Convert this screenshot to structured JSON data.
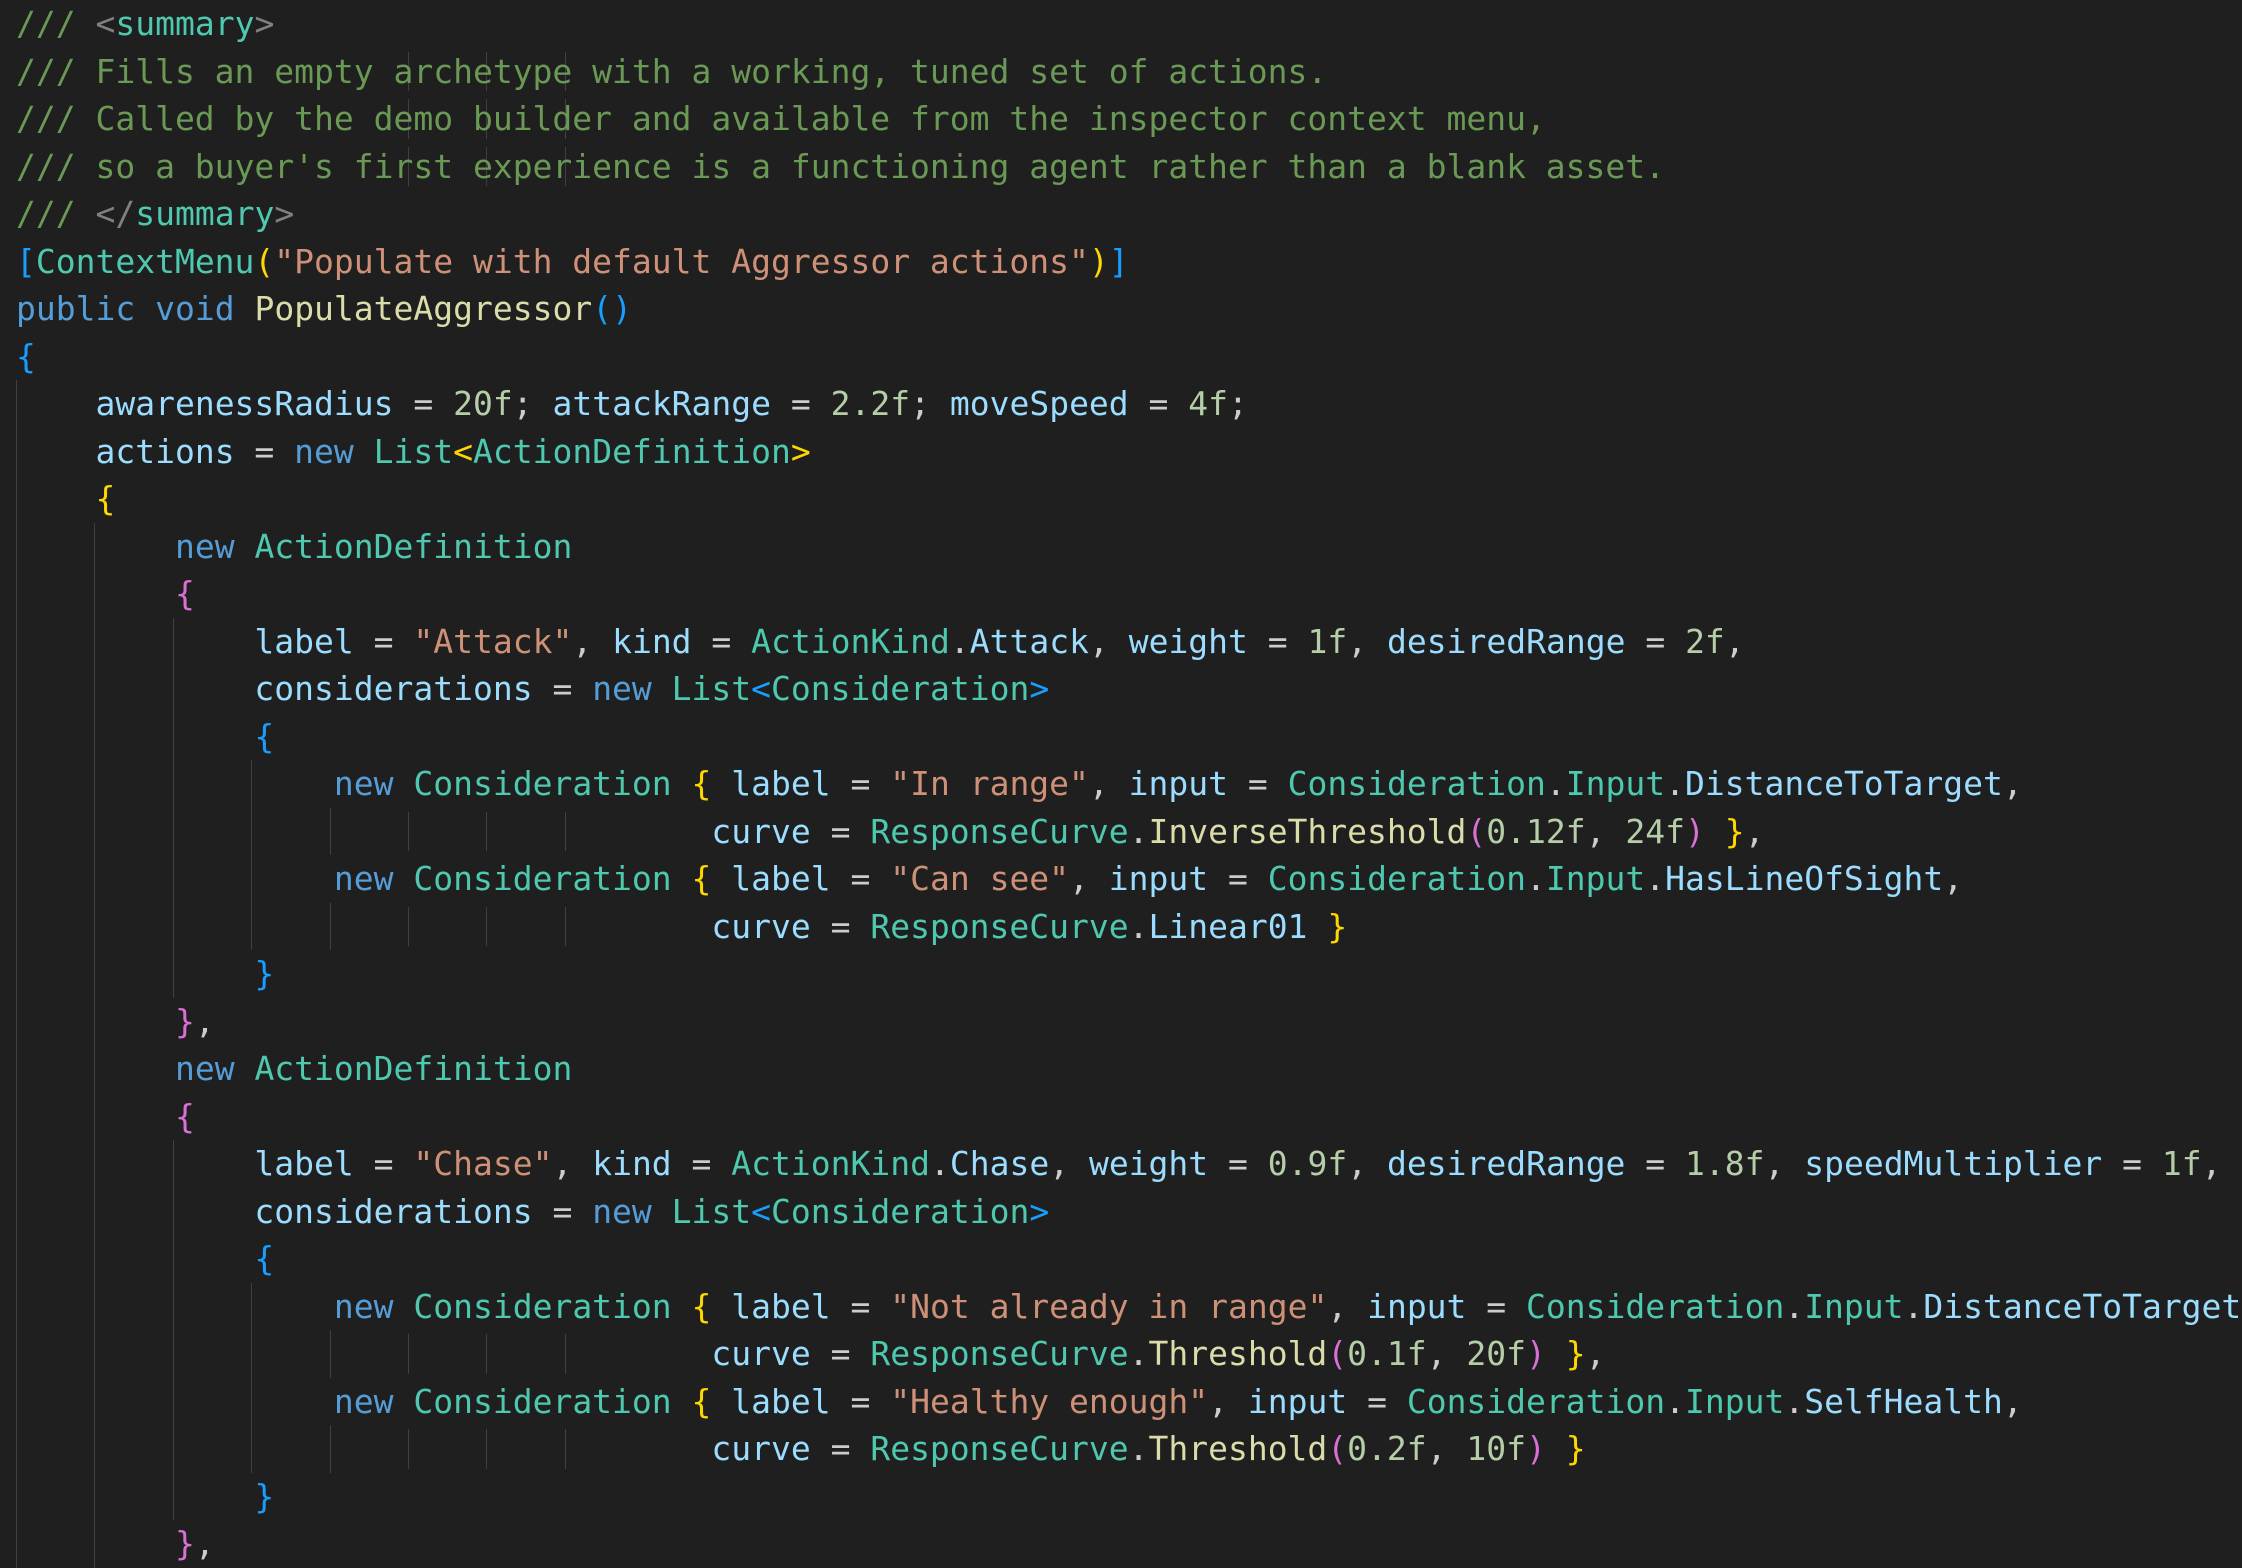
{
  "editor": {
    "language": "csharp",
    "colors": {
      "background": "#1f1f1f",
      "comment": "#6a9955",
      "keyword": "#569cd6",
      "type": "#4ec9b0",
      "method": "#dcdcaa",
      "string": "#ce9178",
      "number": "#b5cea8",
      "identifier": "#9cdcfe",
      "plain": "#cccccc",
      "bracket_level_1": "#ffd700",
      "bracket_level_2": "#da70d6",
      "bracket_level_3": "#179fff"
    },
    "lines": [
      [
        [
          "t-comment",
          "/// "
        ],
        [
          "t-tag",
          "<"
        ],
        [
          "t-tagname",
          "summary"
        ],
        [
          "t-tag",
          ">"
        ]
      ],
      [
        [
          "t-comment",
          "/// Fills an empty archetype with a working, tuned set of actions."
        ]
      ],
      [
        [
          "t-comment",
          "/// Called by the demo builder and available from the inspector context menu,"
        ]
      ],
      [
        [
          "t-comment",
          "/// so a buyer's first experience is a functioning agent rather than a blank asset."
        ]
      ],
      [
        [
          "t-comment",
          "/// "
        ],
        [
          "t-tag",
          "</"
        ],
        [
          "t-tagname",
          "summary"
        ],
        [
          "t-tag",
          ">"
        ]
      ],
      [
        [
          "t-b3",
          "["
        ],
        [
          "t-type",
          "ContextMenu"
        ],
        [
          "t-b1",
          "("
        ],
        [
          "t-string",
          "\"Populate with default Aggressor actions\""
        ],
        [
          "t-b1",
          ")"
        ],
        [
          "t-b3",
          "]"
        ]
      ],
      [
        [
          "t-keyword",
          "public"
        ],
        [
          "t-plain",
          " "
        ],
        [
          "t-keyword",
          "void"
        ],
        [
          "t-plain",
          " "
        ],
        [
          "t-method",
          "PopulateAggressor"
        ],
        [
          "t-b3",
          "()"
        ]
      ],
      [
        [
          "t-b3",
          "{"
        ]
      ],
      [
        [
          "t-plain",
          "    "
        ],
        [
          "t-ident",
          "awarenessRadius"
        ],
        [
          "t-plain",
          " = "
        ],
        [
          "t-number",
          "20f"
        ],
        [
          "t-plain",
          "; "
        ],
        [
          "t-ident",
          "attackRange"
        ],
        [
          "t-plain",
          " = "
        ],
        [
          "t-number",
          "2.2f"
        ],
        [
          "t-plain",
          "; "
        ],
        [
          "t-ident",
          "moveSpeed"
        ],
        [
          "t-plain",
          " = "
        ],
        [
          "t-number",
          "4f"
        ],
        [
          "t-plain",
          ";"
        ]
      ],
      [
        [
          "t-plain",
          "    "
        ],
        [
          "t-ident",
          "actions"
        ],
        [
          "t-plain",
          " = "
        ],
        [
          "t-keyword",
          "new"
        ],
        [
          "t-plain",
          " "
        ],
        [
          "t-type",
          "List"
        ],
        [
          "t-b1",
          "<"
        ],
        [
          "t-type",
          "ActionDefinition"
        ],
        [
          "t-b1",
          ">"
        ]
      ],
      [
        [
          "t-plain",
          "    "
        ],
        [
          "t-b1",
          "{"
        ]
      ],
      [
        [
          "t-plain",
          "        "
        ],
        [
          "t-keyword",
          "new"
        ],
        [
          "t-plain",
          " "
        ],
        [
          "t-type",
          "ActionDefinition"
        ]
      ],
      [
        [
          "t-plain",
          "        "
        ],
        [
          "t-b2",
          "{"
        ]
      ],
      [
        [
          "t-plain",
          "            "
        ],
        [
          "t-ident",
          "label"
        ],
        [
          "t-plain",
          " = "
        ],
        [
          "t-string",
          "\"Attack\""
        ],
        [
          "t-plain",
          ", "
        ],
        [
          "t-ident",
          "kind"
        ],
        [
          "t-plain",
          " = "
        ],
        [
          "t-type",
          "ActionKind"
        ],
        [
          "t-plain",
          "."
        ],
        [
          "t-ident",
          "Attack"
        ],
        [
          "t-plain",
          ", "
        ],
        [
          "t-ident",
          "weight"
        ],
        [
          "t-plain",
          " = "
        ],
        [
          "t-number",
          "1f"
        ],
        [
          "t-plain",
          ", "
        ],
        [
          "t-ident",
          "desiredRange"
        ],
        [
          "t-plain",
          " = "
        ],
        [
          "t-number",
          "2f"
        ],
        [
          "t-plain",
          ","
        ]
      ],
      [
        [
          "t-plain",
          "            "
        ],
        [
          "t-ident",
          "considerations"
        ],
        [
          "t-plain",
          " = "
        ],
        [
          "t-keyword",
          "new"
        ],
        [
          "t-plain",
          " "
        ],
        [
          "t-type",
          "List"
        ],
        [
          "t-b3",
          "<"
        ],
        [
          "t-type",
          "Consideration"
        ],
        [
          "t-b3",
          ">"
        ]
      ],
      [
        [
          "t-plain",
          "            "
        ],
        [
          "t-b3",
          "{"
        ]
      ],
      [
        [
          "t-plain",
          "                "
        ],
        [
          "t-keyword",
          "new"
        ],
        [
          "t-plain",
          " "
        ],
        [
          "t-type",
          "Consideration"
        ],
        [
          "t-plain",
          " "
        ],
        [
          "t-b1",
          "{"
        ],
        [
          "t-plain",
          " "
        ],
        [
          "t-ident",
          "label"
        ],
        [
          "t-plain",
          " = "
        ],
        [
          "t-string",
          "\"In range\""
        ],
        [
          "t-plain",
          ", "
        ],
        [
          "t-ident",
          "input"
        ],
        [
          "t-plain",
          " = "
        ],
        [
          "t-type",
          "Consideration"
        ],
        [
          "t-plain",
          "."
        ],
        [
          "t-type",
          "Input"
        ],
        [
          "t-plain",
          "."
        ],
        [
          "t-ident",
          "DistanceToTarget"
        ],
        [
          "t-plain",
          ","
        ]
      ],
      [
        [
          "t-plain",
          "                                   "
        ],
        [
          "t-ident",
          "curve"
        ],
        [
          "t-plain",
          " = "
        ],
        [
          "t-type",
          "ResponseCurve"
        ],
        [
          "t-plain",
          "."
        ],
        [
          "t-method",
          "InverseThreshold"
        ],
        [
          "t-b2",
          "("
        ],
        [
          "t-number",
          "0.12f"
        ],
        [
          "t-plain",
          ", "
        ],
        [
          "t-number",
          "24f"
        ],
        [
          "t-b2",
          ")"
        ],
        [
          "t-plain",
          " "
        ],
        [
          "t-b1",
          "}"
        ],
        [
          "t-plain",
          ","
        ]
      ],
      [
        [
          "t-plain",
          "                "
        ],
        [
          "t-keyword",
          "new"
        ],
        [
          "t-plain",
          " "
        ],
        [
          "t-type",
          "Consideration"
        ],
        [
          "t-plain",
          " "
        ],
        [
          "t-b1",
          "{"
        ],
        [
          "t-plain",
          " "
        ],
        [
          "t-ident",
          "label"
        ],
        [
          "t-plain",
          " = "
        ],
        [
          "t-string",
          "\"Can see\""
        ],
        [
          "t-plain",
          ", "
        ],
        [
          "t-ident",
          "input"
        ],
        [
          "t-plain",
          " = "
        ],
        [
          "t-type",
          "Consideration"
        ],
        [
          "t-plain",
          "."
        ],
        [
          "t-type",
          "Input"
        ],
        [
          "t-plain",
          "."
        ],
        [
          "t-ident",
          "HasLineOfSight"
        ],
        [
          "t-plain",
          ","
        ]
      ],
      [
        [
          "t-plain",
          "                                   "
        ],
        [
          "t-ident",
          "curve"
        ],
        [
          "t-plain",
          " = "
        ],
        [
          "t-type",
          "ResponseCurve"
        ],
        [
          "t-plain",
          "."
        ],
        [
          "t-ident",
          "Linear01"
        ],
        [
          "t-plain",
          " "
        ],
        [
          "t-b1",
          "}"
        ]
      ],
      [
        [
          "t-plain",
          "            "
        ],
        [
          "t-b3",
          "}"
        ]
      ],
      [
        [
          "t-plain",
          "        "
        ],
        [
          "t-b2",
          "}"
        ],
        [
          "t-plain",
          ","
        ]
      ],
      [
        [
          "t-plain",
          "        "
        ],
        [
          "t-keyword",
          "new"
        ],
        [
          "t-plain",
          " "
        ],
        [
          "t-type",
          "ActionDefinition"
        ]
      ],
      [
        [
          "t-plain",
          "        "
        ],
        [
          "t-b2",
          "{"
        ]
      ],
      [
        [
          "t-plain",
          "            "
        ],
        [
          "t-ident",
          "label"
        ],
        [
          "t-plain",
          " = "
        ],
        [
          "t-string",
          "\"Chase\""
        ],
        [
          "t-plain",
          ", "
        ],
        [
          "t-ident",
          "kind"
        ],
        [
          "t-plain",
          " = "
        ],
        [
          "t-type",
          "ActionKind"
        ],
        [
          "t-plain",
          "."
        ],
        [
          "t-ident",
          "Chase"
        ],
        [
          "t-plain",
          ", "
        ],
        [
          "t-ident",
          "weight"
        ],
        [
          "t-plain",
          " = "
        ],
        [
          "t-number",
          "0.9f"
        ],
        [
          "t-plain",
          ", "
        ],
        [
          "t-ident",
          "desiredRange"
        ],
        [
          "t-plain",
          " = "
        ],
        [
          "t-number",
          "1.8f"
        ],
        [
          "t-plain",
          ", "
        ],
        [
          "t-ident",
          "speedMultiplier"
        ],
        [
          "t-plain",
          " = "
        ],
        [
          "t-number",
          "1f"
        ],
        [
          "t-plain",
          ","
        ]
      ],
      [
        [
          "t-plain",
          "            "
        ],
        [
          "t-ident",
          "considerations"
        ],
        [
          "t-plain",
          " = "
        ],
        [
          "t-keyword",
          "new"
        ],
        [
          "t-plain",
          " "
        ],
        [
          "t-type",
          "List"
        ],
        [
          "t-b3",
          "<"
        ],
        [
          "t-type",
          "Consideration"
        ],
        [
          "t-b3",
          ">"
        ]
      ],
      [
        [
          "t-plain",
          "            "
        ],
        [
          "t-b3",
          "{"
        ]
      ],
      [
        [
          "t-plain",
          "                "
        ],
        [
          "t-keyword",
          "new"
        ],
        [
          "t-plain",
          " "
        ],
        [
          "t-type",
          "Consideration"
        ],
        [
          "t-plain",
          " "
        ],
        [
          "t-b1",
          "{"
        ],
        [
          "t-plain",
          " "
        ],
        [
          "t-ident",
          "label"
        ],
        [
          "t-plain",
          " = "
        ],
        [
          "t-string",
          "\"Not already in range\""
        ],
        [
          "t-plain",
          ", "
        ],
        [
          "t-ident",
          "input"
        ],
        [
          "t-plain",
          " = "
        ],
        [
          "t-type",
          "Consideration"
        ],
        [
          "t-plain",
          "."
        ],
        [
          "t-type",
          "Input"
        ],
        [
          "t-plain",
          "."
        ],
        [
          "t-ident",
          "DistanceToTarget"
        ],
        [
          "t-plain",
          ","
        ]
      ],
      [
        [
          "t-plain",
          "                                   "
        ],
        [
          "t-ident",
          "curve"
        ],
        [
          "t-plain",
          " = "
        ],
        [
          "t-type",
          "ResponseCurve"
        ],
        [
          "t-plain",
          "."
        ],
        [
          "t-method",
          "Threshold"
        ],
        [
          "t-b2",
          "("
        ],
        [
          "t-number",
          "0.1f"
        ],
        [
          "t-plain",
          ", "
        ],
        [
          "t-number",
          "20f"
        ],
        [
          "t-b2",
          ")"
        ],
        [
          "t-plain",
          " "
        ],
        [
          "t-b1",
          "}"
        ],
        [
          "t-plain",
          ","
        ]
      ],
      [
        [
          "t-plain",
          "                "
        ],
        [
          "t-keyword",
          "new"
        ],
        [
          "t-plain",
          " "
        ],
        [
          "t-type",
          "Consideration"
        ],
        [
          "t-plain",
          " "
        ],
        [
          "t-b1",
          "{"
        ],
        [
          "t-plain",
          " "
        ],
        [
          "t-ident",
          "label"
        ],
        [
          "t-plain",
          " = "
        ],
        [
          "t-string",
          "\"Healthy enough\""
        ],
        [
          "t-plain",
          ", "
        ],
        [
          "t-ident",
          "input"
        ],
        [
          "t-plain",
          " = "
        ],
        [
          "t-type",
          "Consideration"
        ],
        [
          "t-plain",
          "."
        ],
        [
          "t-type",
          "Input"
        ],
        [
          "t-plain",
          "."
        ],
        [
          "t-ident",
          "SelfHealth"
        ],
        [
          "t-plain",
          ","
        ]
      ],
      [
        [
          "t-plain",
          "                                   "
        ],
        [
          "t-ident",
          "curve"
        ],
        [
          "t-plain",
          " = "
        ],
        [
          "t-type",
          "ResponseCurve"
        ],
        [
          "t-plain",
          "."
        ],
        [
          "t-method",
          "Threshold"
        ],
        [
          "t-b2",
          "("
        ],
        [
          "t-number",
          "0.2f"
        ],
        [
          "t-plain",
          ", "
        ],
        [
          "t-number",
          "10f"
        ],
        [
          "t-b2",
          ")"
        ],
        [
          "t-plain",
          " "
        ],
        [
          "t-b1",
          "}"
        ]
      ],
      [
        [
          "t-plain",
          "            "
        ],
        [
          "t-b3",
          "}"
        ]
      ],
      [
        [
          "t-plain",
          "        "
        ],
        [
          "t-b2",
          "}"
        ],
        [
          "t-plain",
          ","
        ]
      ]
    ]
  }
}
